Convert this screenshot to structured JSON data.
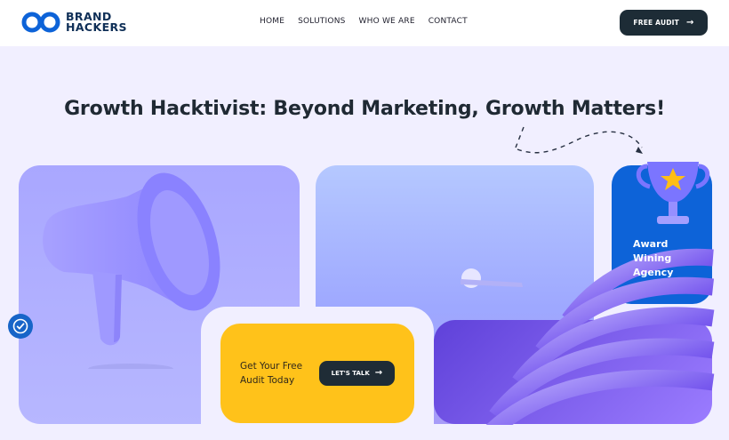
{
  "brand": {
    "line1": "BRAND",
    "line2": "HACKERS",
    "mark": "infinity-logo"
  },
  "nav": {
    "items": [
      "HOME",
      "SOLUTIONS",
      "WHO WE ARE",
      "CONTACT"
    ]
  },
  "header": {
    "audit_label": "FREE AUDIT",
    "audit_icon": "arrow-right-icon"
  },
  "hero": {
    "title": "Growth Hacktivist: Beyond Marketing, Growth Matters!"
  },
  "cta": {
    "text": "Get Your Free Audit Today",
    "button_label": "LET'S TALK",
    "button_icon": "arrow-right-icon"
  },
  "award": {
    "text": "Award Wining Agency",
    "icon": "trophy-icon"
  },
  "visuals": {
    "megaphone": "megaphone-icon",
    "ring_art": "abstract-ring-shape",
    "accessibility": "accessibility-icon"
  },
  "colors": {
    "navy": "#0f2f57",
    "dark_button": "#1d2c36",
    "yellow": "#ffc21a",
    "blue": "#0d63d8",
    "lavender": "#f1efff",
    "purple": "#a9a7ff"
  }
}
